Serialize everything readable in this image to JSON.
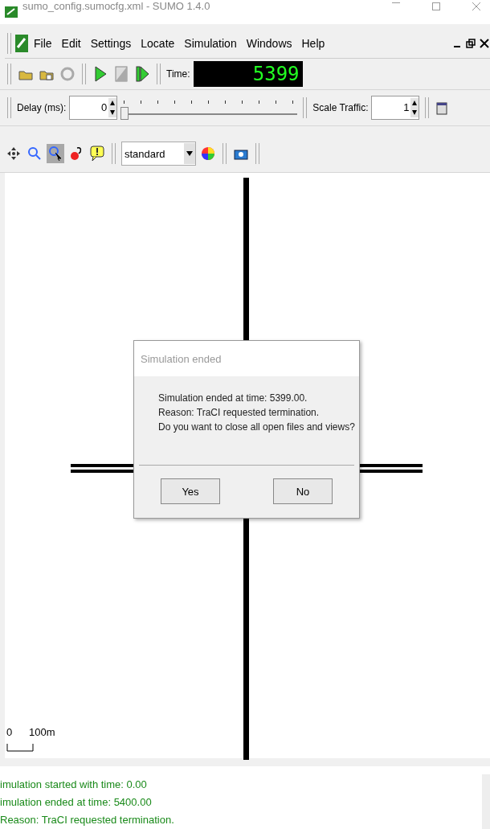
{
  "window": {
    "title": "sumo_config.sumocfg.xml - SUMO 1.4.0"
  },
  "menu": [
    "File",
    "Edit",
    "Settings",
    "Locate",
    "Simulation",
    "Windows",
    "Help"
  ],
  "toolbar": {
    "time_label": "Time:",
    "time_value": "5399"
  },
  "delay": {
    "label": "Delay (ms):",
    "value": "0",
    "level": 0
  },
  "scale_traffic": {
    "label": "Scale Traffic:",
    "value": "1"
  },
  "view": {
    "scheme": "standard",
    "locate_selected": true
  },
  "canvas": {
    "scale_zero": "0",
    "scale_label": "100m"
  },
  "dialog": {
    "title": "Simulation ended",
    "lines": [
      "Simulation ended at time: 5399.00.",
      "Reason: TraCI requested termination.",
      "Do you want to close all open files and views?"
    ],
    "buttons": [
      "Yes",
      "No"
    ]
  },
  "log": [
    "imulation started with time: 0.00",
    "imulation ended at time: 5400.00",
    "Reason: TraCI requested termination."
  ]
}
